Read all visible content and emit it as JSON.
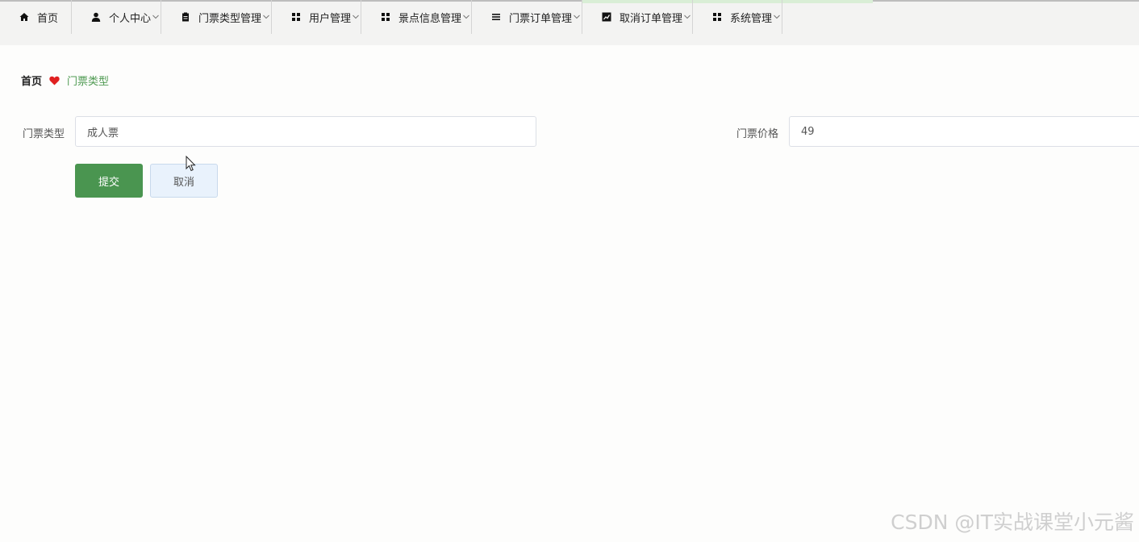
{
  "nav": {
    "items": [
      {
        "label": "首页",
        "icon": "home-icon",
        "has_dropdown": false
      },
      {
        "label": "个人中心",
        "icon": "user-icon",
        "has_dropdown": true
      },
      {
        "label": "门票类型管理",
        "icon": "clipboard-icon",
        "has_dropdown": true
      },
      {
        "label": "用户管理",
        "icon": "grid-icon",
        "has_dropdown": true
      },
      {
        "label": "景点信息管理",
        "icon": "grid-icon",
        "has_dropdown": true
      },
      {
        "label": "门票订单管理",
        "icon": "list-icon",
        "has_dropdown": true
      },
      {
        "label": "取消订单管理",
        "icon": "chart-icon",
        "has_dropdown": true
      },
      {
        "label": "系统管理",
        "icon": "grid-icon",
        "has_dropdown": true
      }
    ]
  },
  "breadcrumb": {
    "home": "首页",
    "separator_icon": "heart-icon",
    "current": "门票类型"
  },
  "form": {
    "ticket_type_label": "门票类型",
    "ticket_type_value": "成人票",
    "ticket_price_label": "门票价格",
    "ticket_price_value": "49",
    "submit_label": "提交",
    "cancel_label": "取消"
  },
  "watermark": "CSDN @IT实战课堂小元酱",
  "colors": {
    "accent": "#4a9550",
    "breadcrumb_current": "#4f9a52",
    "heart": "#e02020",
    "cancel_bg": "#e9f2fc"
  }
}
